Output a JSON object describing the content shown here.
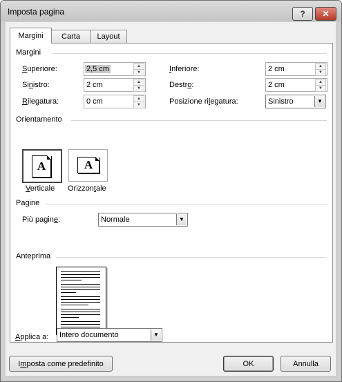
{
  "window": {
    "title": "Imposta pagina",
    "help_label": "?",
    "close_label": "✕"
  },
  "tabs": [
    {
      "label": "Margini"
    },
    {
      "label": "Carta"
    },
    {
      "label": "Layout"
    }
  ],
  "margini": {
    "heading": "Margini",
    "superiore": {
      "label_u": "S",
      "label_rest": "uperiore:",
      "value": "2,5 cm"
    },
    "inferiore": {
      "label_u": "I",
      "label_rest": "nferiore:",
      "value": "2 cm"
    },
    "sinistro": {
      "label_pre": "Si",
      "label_u": "n",
      "label_rest": "istro:",
      "value": "2 cm"
    },
    "destro": {
      "label_pre": "Destr",
      "label_u": "o",
      "label_rest": ":",
      "value": "2 cm"
    },
    "rilegatura": {
      "label_u": "R",
      "label_rest": "ilegatura:",
      "value": "0 cm"
    },
    "posizione": {
      "label_pre": "Posizione ri",
      "label_u": "l",
      "label_rest": "egatura:",
      "value": "Sinistro"
    }
  },
  "orientamento": {
    "heading": "Orientamento",
    "glyph": "A",
    "verticale": {
      "label_u": "V",
      "label_rest": "erticale"
    },
    "orizzontale": {
      "label_pre": "Orizzon",
      "label_u": "t",
      "label_rest": "ale"
    }
  },
  "pagine": {
    "heading": "Pagine",
    "piu_pagine": {
      "label_pre": "Più pagin",
      "label_u": "e",
      "label_rest": ":",
      "value": "Normale"
    }
  },
  "anteprima": {
    "heading": "Anteprima"
  },
  "applica": {
    "label_u": "A",
    "label_rest": "pplica a:",
    "value": "Intero documento"
  },
  "buttons": {
    "predefinito": {
      "label_pre": "I",
      "label_u": "m",
      "label_rest": "posta come predefinito"
    },
    "ok": "OK",
    "annulla": "Annulla"
  },
  "icons": {
    "spin_up": "▲",
    "spin_down": "▼",
    "dropdown": "▼"
  }
}
